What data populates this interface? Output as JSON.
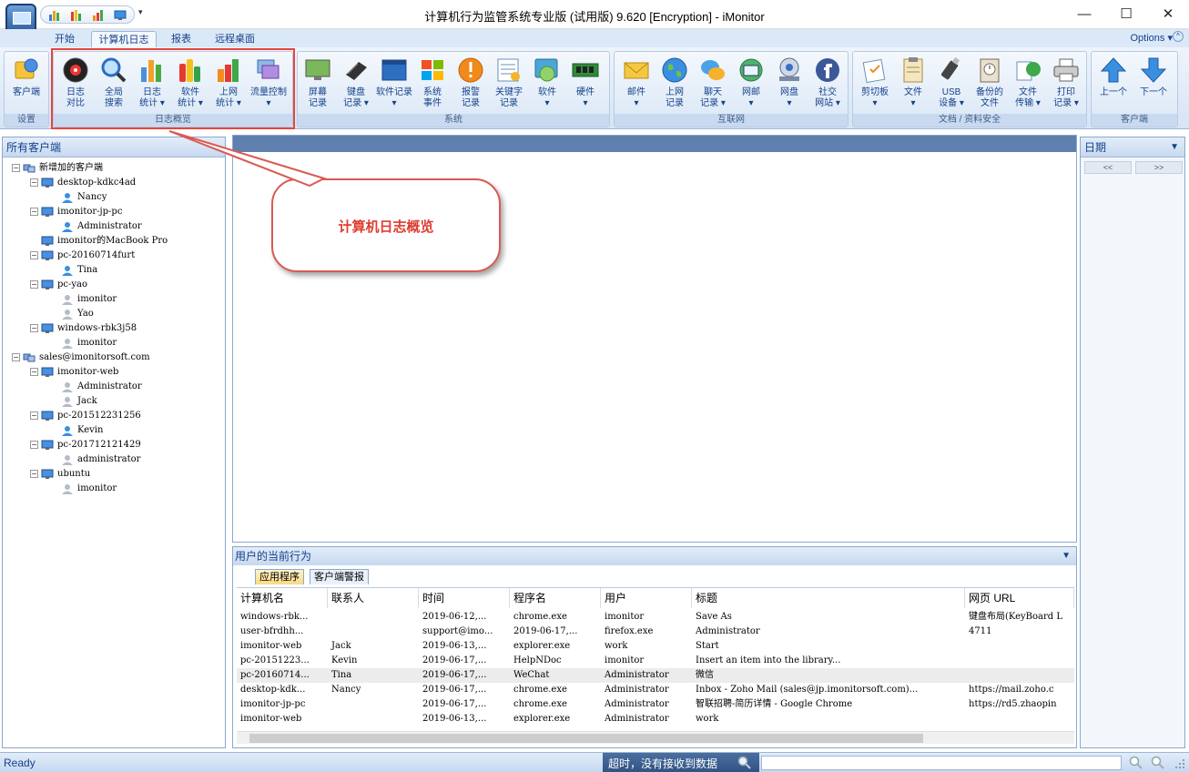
{
  "window": {
    "title": "计算机行为监管系统专业版 (试用版) 9.620 [Encryption] - iMonitor",
    "minimize": "—",
    "maximize": "☐",
    "close": "✕",
    "qat_dropdown": "▾"
  },
  "tabs": [
    "开始",
    "计算机日志",
    "报表",
    "远程桌面"
  ],
  "active_tab": "计算机日志",
  "options": "Options ▾",
  "ribbon_minimize": "^",
  "groups": [
    {
      "label": "设置",
      "buttons": [
        {
          "label": "客户端",
          "icon": "client-icon"
        }
      ]
    },
    {
      "label": "日志概览",
      "buttons": [
        {
          "label": "日志\n对比",
          "icon": "log-compare-icon"
        },
        {
          "label": "全局\n搜索",
          "icon": "global-search-icon"
        },
        {
          "label": "日志\n统计 ▾",
          "icon": "log-stats-icon"
        },
        {
          "label": "软件\n统计 ▾",
          "icon": "software-stats-icon"
        },
        {
          "label": "上网\n统计 ▾",
          "icon": "internet-stats-icon"
        },
        {
          "label": "流量控制\n▾",
          "icon": "traffic-control-icon"
        }
      ]
    },
    {
      "label": "系统",
      "buttons": [
        {
          "label": "屏幕\n记录",
          "icon": "screen-record-icon"
        },
        {
          "label": "键盘\n记录 ▾",
          "icon": "keyboard-record-icon"
        },
        {
          "label": "软件记录\n▾",
          "icon": "software-record-icon"
        },
        {
          "label": "系统\n事件",
          "icon": "system-event-icon"
        },
        {
          "label": "报警\n记录",
          "icon": "alarm-record-icon"
        },
        {
          "label": "关键字\n记录",
          "icon": "keyword-record-icon"
        },
        {
          "label": "软件\n▾",
          "icon": "software-icon"
        },
        {
          "label": "硬件\n▾",
          "icon": "hardware-icon"
        }
      ]
    },
    {
      "label": "互联网",
      "buttons": [
        {
          "label": "邮件\n▾",
          "icon": "mail-icon"
        },
        {
          "label": "上网\n记录",
          "icon": "web-record-icon"
        },
        {
          "label": "聊天\n记录 ▾",
          "icon": "chat-record-icon"
        },
        {
          "label": "网邮\n▾",
          "icon": "webmail-icon"
        },
        {
          "label": "网盘\n▾",
          "icon": "netdisk-icon"
        },
        {
          "label": "社交\n网站 ▾",
          "icon": "social-icon"
        }
      ]
    },
    {
      "label": "文档 / 资料安全",
      "buttons": [
        {
          "label": "剪切板\n▾",
          "icon": "clipboard-icon"
        },
        {
          "label": "文件\n▾",
          "icon": "file-icon"
        },
        {
          "label": "USB\n设备 ▾",
          "icon": "usb-icon"
        },
        {
          "label": "备份的\n文件",
          "icon": "backup-icon"
        },
        {
          "label": "文件\n传输 ▾",
          "icon": "file-transfer-icon"
        },
        {
          "label": "打印\n记录 ▾",
          "icon": "print-record-icon"
        }
      ]
    },
    {
      "label": "客户端",
      "buttons": [
        {
          "label": "上一个",
          "icon": "arrow-up-icon"
        },
        {
          "label": "下一个",
          "icon": "arrow-down-icon"
        }
      ]
    }
  ],
  "left_panel": {
    "title": "所有客户端",
    "tree": [
      {
        "label": "新增加的客户端",
        "level": 0,
        "type": "group",
        "expander": "−"
      },
      {
        "label": "desktop-kdkc4ad",
        "level": 1,
        "type": "pc",
        "expander": "−"
      },
      {
        "label": "Nancy",
        "level": 2,
        "type": "user-blue"
      },
      {
        "label": "imonitor-jp-pc",
        "level": 1,
        "type": "pc",
        "expander": "−"
      },
      {
        "label": "Administrator",
        "level": 2,
        "type": "user-blue"
      },
      {
        "label": "imonitor的MacBook Pro",
        "level": 1,
        "type": "pc"
      },
      {
        "label": "pc-20160714furt",
        "level": 1,
        "type": "pc",
        "expander": "−"
      },
      {
        "label": "Tina",
        "level": 2,
        "type": "user-blue"
      },
      {
        "label": "pc-yao",
        "level": 1,
        "type": "pc",
        "expander": "−"
      },
      {
        "label": "imonitor",
        "level": 2,
        "type": "user-gray"
      },
      {
        "label": "Yao",
        "level": 2,
        "type": "user-gray"
      },
      {
        "label": "windows-rbk3j58",
        "level": 1,
        "type": "pc",
        "expander": "−"
      },
      {
        "label": "imonitor",
        "level": 2,
        "type": "user-gray"
      },
      {
        "label": "sales@imonitorsoft.com",
        "level": 0,
        "type": "group",
        "expander": "−"
      },
      {
        "label": "imonitor-web",
        "level": 1,
        "type": "pc",
        "expander": "−"
      },
      {
        "label": "Administrator",
        "level": 2,
        "type": "user-gray"
      },
      {
        "label": "Jack",
        "level": 2,
        "type": "user-gray"
      },
      {
        "label": "pc-201512231256",
        "level": 1,
        "type": "pc",
        "expander": "−"
      },
      {
        "label": "Kevin",
        "level": 2,
        "type": "user-blue"
      },
      {
        "label": "pc-201712121429",
        "level": 1,
        "type": "pc",
        "expander": "−"
      },
      {
        "label": "administrator",
        "level": 2,
        "type": "user-gray"
      },
      {
        "label": "ubuntu",
        "level": 1,
        "type": "pc",
        "expander": "−"
      },
      {
        "label": "imonitor",
        "level": 2,
        "type": "user-gray"
      }
    ]
  },
  "callout": {
    "text": "计算机日志概览"
  },
  "right_panel": {
    "title": "日期",
    "prev": "<<",
    "next": ">>",
    "collapse": "▼"
  },
  "bottom_panel": {
    "title": "用户的当前行为",
    "collapse": "▼",
    "tabs": [
      "应用程序",
      "客户端警报"
    ],
    "columns": [
      "计算机名",
      "联系人",
      "时间",
      "程序名",
      "用户",
      "标题",
      "网页 URL"
    ],
    "rows": [
      [
        "windows-rbk...",
        "",
        "2019-06-12,...",
        "chrome.exe",
        "imonitor",
        "Save As",
        "键盘布局(KeyBoard L"
      ],
      [
        "user-bfrdhh...",
        "",
        "support@imo...",
        "2019-06-17,...",
        "firefox.exe",
        "Administrator",
        "4711"
      ],
      [
        "imonitor-web",
        "Jack",
        "2019-06-13,...",
        "explorer.exe",
        "work",
        "Start",
        ""
      ],
      [
        "pc-20151223...",
        "Kevin",
        "2019-06-17,...",
        "HelpNDoc",
        "imonitor",
        "Insert an item into the library...",
        ""
      ],
      [
        "pc-20160714...",
        "Tina",
        "2019-06-17,...",
        "WeChat",
        "Administrator",
        "微信",
        ""
      ],
      [
        "desktop-kdk...",
        "Nancy",
        "2019-06-17,...",
        "chrome.exe",
        "Administrator",
        "Inbox - Zoho Mail (sales@jp.imonitorsoft.com)...",
        "https://mail.zoho.c"
      ],
      [
        "imonitor-jp-pc",
        "",
        "2019-06-17,...",
        "chrome.exe",
        "Administrator",
        "智联招聘-简历详情 - Google Chrome",
        "https://rd5.zhaopin"
      ],
      [
        "imonitor-web",
        "",
        "2019-06-13,...",
        "explorer.exe",
        "Administrator",
        "work",
        ""
      ]
    ],
    "selected_row": 4
  },
  "status": {
    "ready": "Ready",
    "message": "超时，没有接收到数据"
  },
  "colors": {
    "accent": "#15428b",
    "highlight": "#e8453c",
    "callout_text": "#e03c30"
  }
}
